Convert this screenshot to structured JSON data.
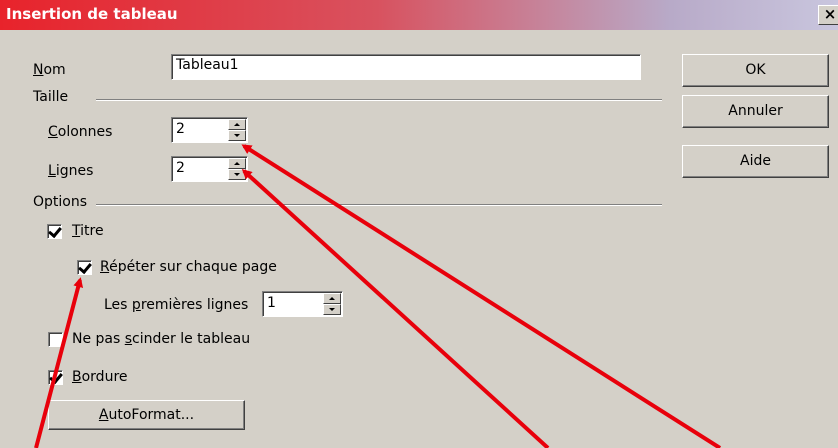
{
  "window": {
    "title": "Insertion de tableau",
    "close_label": "×"
  },
  "name_label": {
    "pre": "",
    "u": "N",
    "post": "om"
  },
  "name_value": "Tableau1",
  "size_group": "Taille",
  "columns_label": {
    "pre": "",
    "u": "C",
    "post": "olonnes"
  },
  "columns_value": "2",
  "rows_label": {
    "pre": "",
    "u": "L",
    "post": "ignes"
  },
  "rows_value": "2",
  "options_group": "Options",
  "title_check": {
    "pre": "",
    "u": "T",
    "post": "itre",
    "checked": true
  },
  "repeat_check": {
    "pre": "",
    "u": "R",
    "post": "épéter sur chaque page",
    "checked": true
  },
  "first_rows_label": {
    "pre": "Les ",
    "u": "p",
    "post": "remières lignes"
  },
  "first_rows_value": "1",
  "nosplit_check": {
    "pre": "Ne pas ",
    "u": "s",
    "post": "cinder le tableau",
    "checked": false
  },
  "border_check": {
    "pre": "",
    "u": "B",
    "post": "ordure",
    "checked": true
  },
  "autoformat_button": {
    "pre": "",
    "u": "A",
    "post": "utoFormat..."
  },
  "buttons": {
    "ok": "OK",
    "cancel": "Annuler",
    "help": "Aide"
  },
  "annotation_color": "#e8000b",
  "icons": {
    "close": "close-icon",
    "spin_up": "spin-up-icon",
    "spin_down": "spin-down-icon",
    "checkmark": "checkmark-icon"
  }
}
